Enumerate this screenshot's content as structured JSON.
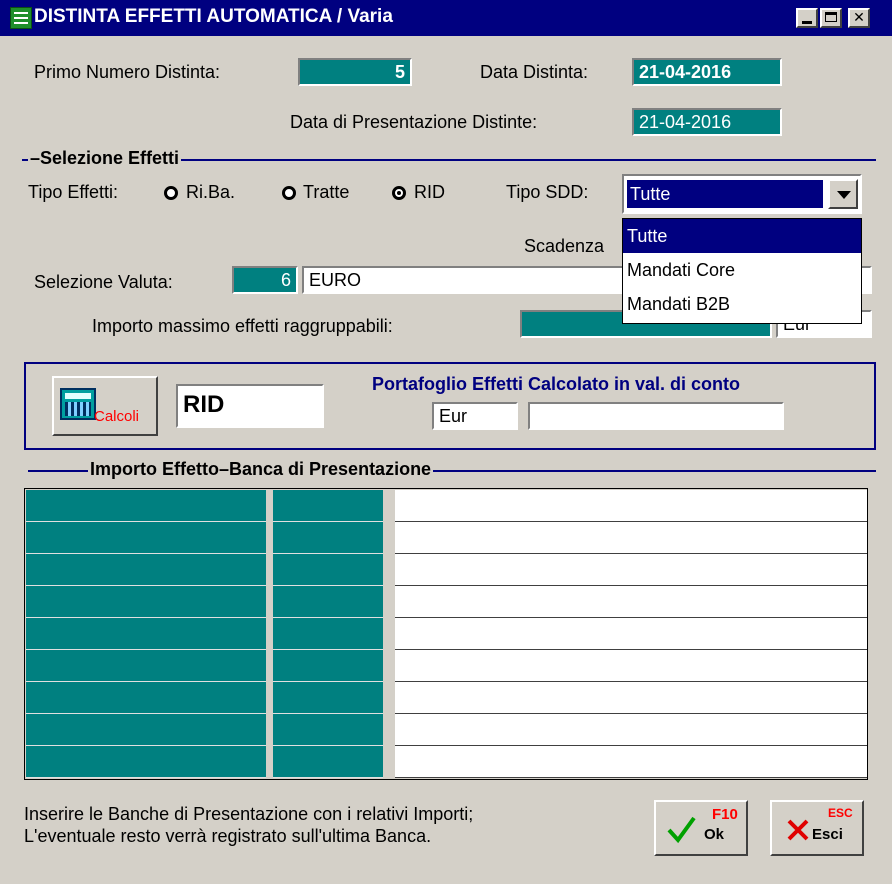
{
  "window": {
    "title": "DISTINTA EFFETTI AUTOMATICA / Varia",
    "controls": [
      "minimize",
      "maximize",
      "close"
    ]
  },
  "header": {
    "primo_numero_label": "Primo Numero Distinta:",
    "primo_numero_value": "5",
    "data_distinta_label": "Data Distinta:",
    "data_distinta_value": "21-04-2016",
    "data_presentazione_label": "Data di Presentazione Distinte:",
    "data_presentazione_value": "21-04-2016"
  },
  "selezione": {
    "section_title": "Selezione Effetti",
    "tipo_effetti_label": "Tipo Effetti:",
    "options": [
      {
        "label": "Ri.Ba.",
        "selected": false
      },
      {
        "label": "Tratte",
        "selected": false
      },
      {
        "label": "RID",
        "selected": true
      }
    ],
    "tipo_sdd_label": "Tipo SDD:",
    "tipo_sdd_value": "Tutte",
    "tipo_sdd_options": [
      "Tutte",
      "Mandati Core",
      "Mandati B2B"
    ],
    "scadenza_label": "Scadenza",
    "valuta_label": "Selezione Valuta:",
    "valuta_code": "6",
    "valuta_name": "EURO",
    "importo_label": "Importo massimo effetti raggruppabili:",
    "importo_value": "",
    "importo_currency": "Eur"
  },
  "calcoli": {
    "button_label": "Calcoli",
    "tipo_value": "RID",
    "portafoglio_label": "Portafoglio Effetti Calcolato in val. di conto",
    "currency": "Eur",
    "amount": ""
  },
  "grid": {
    "title_importo": "Importo Effetto",
    "title_banca": "Banca di Presentazione",
    "row_count": 9
  },
  "footer": {
    "message_line1": "Inserire le Banche di Presentazione con i relativi Importi;",
    "message_line2": "L'eventuale resto verrà registrato sull'ultima Banca.",
    "ok_label": "Ok",
    "ok_key": "F10",
    "esc_label": "Esci",
    "esc_key": "ESC"
  },
  "colors": {
    "teal": "#008080",
    "navy": "#000080",
    "face": "#d4d0c8"
  }
}
